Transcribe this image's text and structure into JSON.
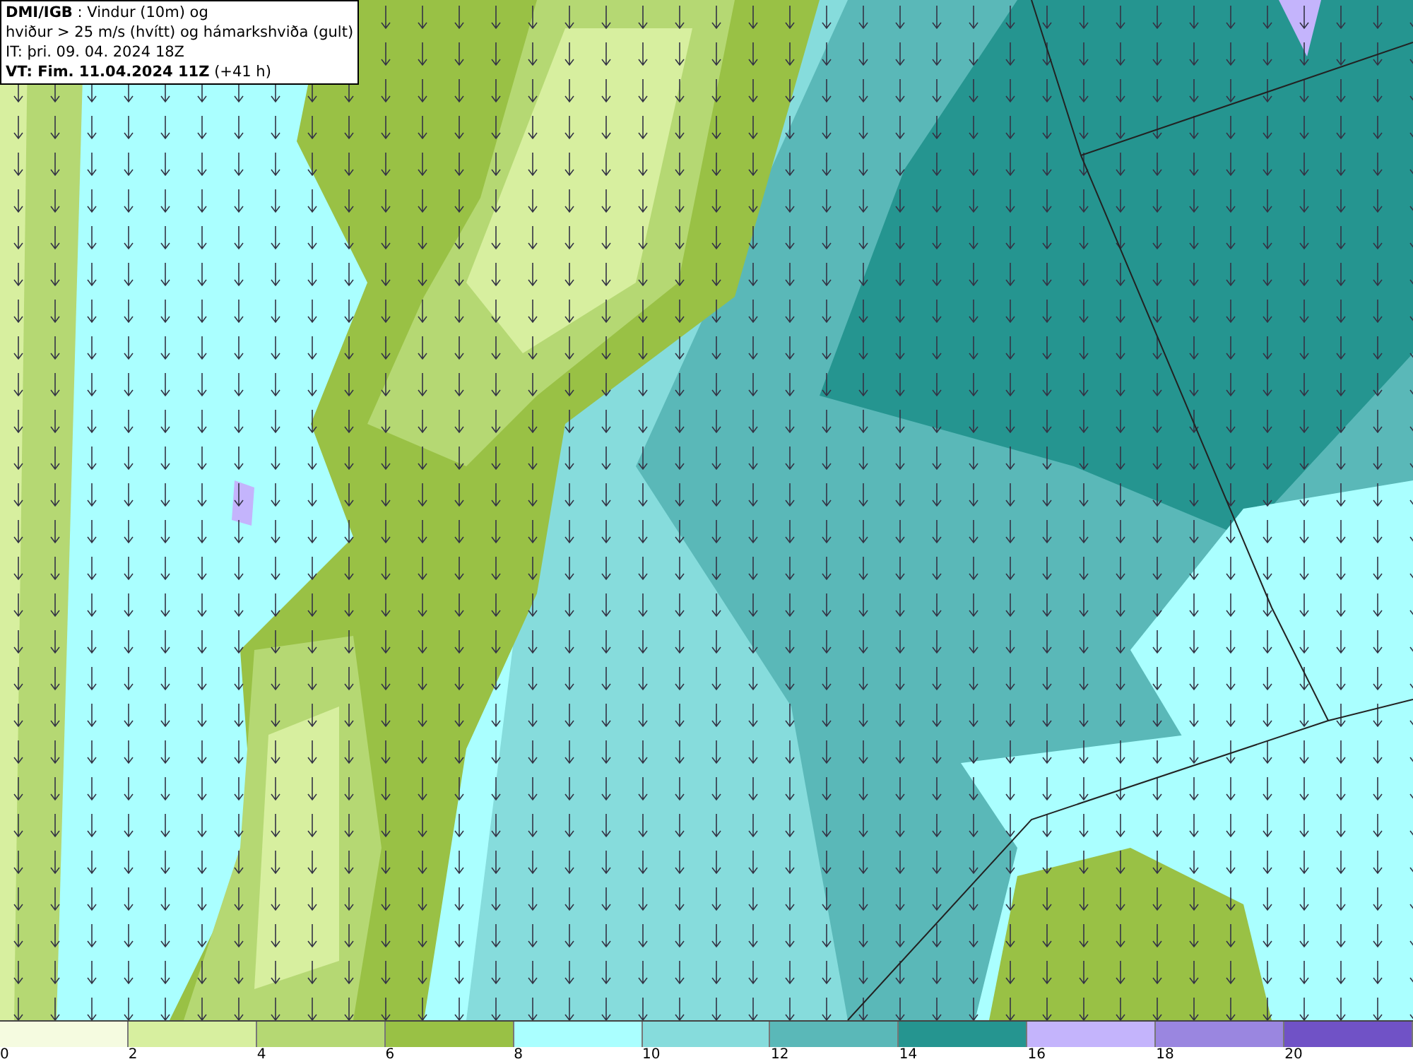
{
  "title_box": {
    "lines": [
      "**DMI/IGB** : Vindur (10m) og",
      "hviður > 25 m/s (hvítt) og hámarkshviða (gult)",
      "IT: þri. 09. 04. 2024 18Z",
      "**VT: Fim. 11.04.2024 11Z** (+41 h)"
    ]
  },
  "legend": [
    {
      "label": "0",
      "color": "#f5fbe0"
    },
    {
      "label": "2",
      "color": "#d7ef9f"
    },
    {
      "label": "4",
      "color": "#b5d873"
    },
    {
      "label": "6",
      "color": "#99c145"
    },
    {
      "label": "8",
      "color": "#aaffff"
    },
    {
      "label": "10",
      "color": "#86dcdc"
    },
    {
      "label": "12",
      "color": "#5ab8b8"
    },
    {
      "label": "14",
      "color": "#259590"
    },
    {
      "label": "16",
      "color": "#c4b4fc"
    },
    {
      "label": "18",
      "color": "#9a86e0"
    },
    {
      "label": "20",
      "color": "#7052c6"
    }
  ]
}
